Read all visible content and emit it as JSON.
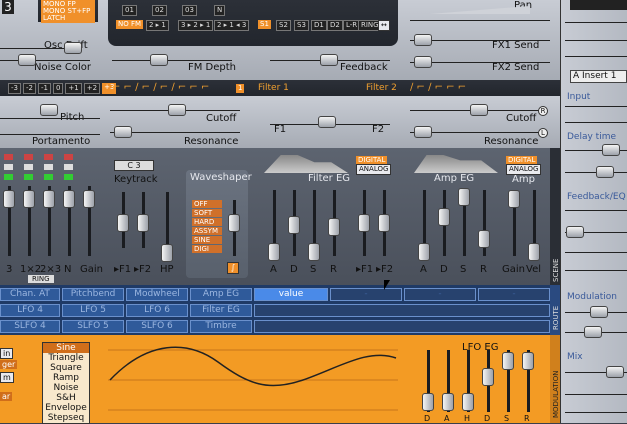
{
  "top": {
    "play_modes": [
      "MONO FP",
      "MONO ST+FP",
      "LATCH"
    ],
    "page_num": "3",
    "osc_nums": [
      "01",
      "02",
      "03"
    ],
    "osc_n": "N",
    "fm_tags": [
      "NO FM",
      "2 ▸ 1",
      "3 ▸ 2 ▸ 1",
      "2 ▸ 1 ◂ 3"
    ],
    "route_tags": [
      "S1",
      "S2",
      "S3",
      "D1",
      "D2",
      "L-R",
      "RING",
      "↔"
    ],
    "osc_drift": "Osc Drift",
    "noise_color": "Noise Color",
    "fm_depth": "FM Depth",
    "feedback": "Feedback",
    "pan": "Pan",
    "fx1_send": "FX1 Send",
    "fx2_send": "FX2 Send"
  },
  "filter_bar": {
    "octaves": [
      "-3",
      "-2",
      "-1",
      "0",
      "+1",
      "+2",
      "+3"
    ],
    "filter1_num": "1",
    "filter1": "Filter 1",
    "filter2": "Filter 2"
  },
  "mid": {
    "pitch": "Pitch",
    "portamento": "Portamento",
    "cutoff1": "Cutoff",
    "resonance1": "Resonance",
    "f1": "F1",
    "f2": "F2",
    "cutoff2": "Cutoff",
    "resonance2": "Resonance",
    "r": "R",
    "l": "L"
  },
  "lower": {
    "mixer_labels": [
      "3",
      "1×2",
      "2×3",
      "N",
      "Gain"
    ],
    "ring": "RING",
    "key": "C 3",
    "keytrack": "Keytrack",
    "kt_labels": [
      "▸F1",
      "▸F2",
      "HP"
    ],
    "waveshaper": "Waveshaper",
    "ws_types": [
      "OFF",
      "SOFT",
      "HARD",
      "ASSYM",
      "SINE",
      "DIGI"
    ],
    "filter_eg": "Filter EG",
    "feg_labels": [
      "A",
      "D",
      "S",
      "R",
      "▸F1",
      "▸F2"
    ],
    "digital": "DIGITAL",
    "analog": "ANALOG",
    "amp_eg": "Amp EG",
    "amp": "Amp",
    "aeg_labels": [
      "A",
      "D",
      "S",
      "R",
      "Gain",
      "Vel"
    ]
  },
  "mod": {
    "row1": [
      "Chan. AT",
      "Pitchbend",
      "Modwheel",
      "Amp EG",
      "value",
      "-",
      "-",
      "-"
    ],
    "row2": [
      "LFO 4",
      "LFO 5",
      "LFO 6",
      "Filter EG"
    ],
    "row3": [
      "SLFO 4",
      "SLFO 5",
      "SLFO 6",
      "Timbre"
    ],
    "scene": "SCENE",
    "route": "ROUTE",
    "modulation": "MODULATION"
  },
  "lfo": {
    "left_tags": [
      "in",
      "ger",
      "m",
      "ar"
    ],
    "shapes": [
      "Sine",
      "Triangle",
      "Square",
      "Ramp",
      "Noise",
      "S&H",
      "Envelope",
      "Stepseq"
    ],
    "lfo_eg": "LFO EG",
    "eg_labels": [
      "D",
      "A",
      "H",
      "D",
      "S",
      "R"
    ]
  },
  "right": {
    "insert": "A Insert 1",
    "input": "Input",
    "delay_time": "Delay time",
    "feedback_eq": "Feedback/EQ",
    "modulation": "Modulation",
    "mix": "Mix"
  }
}
